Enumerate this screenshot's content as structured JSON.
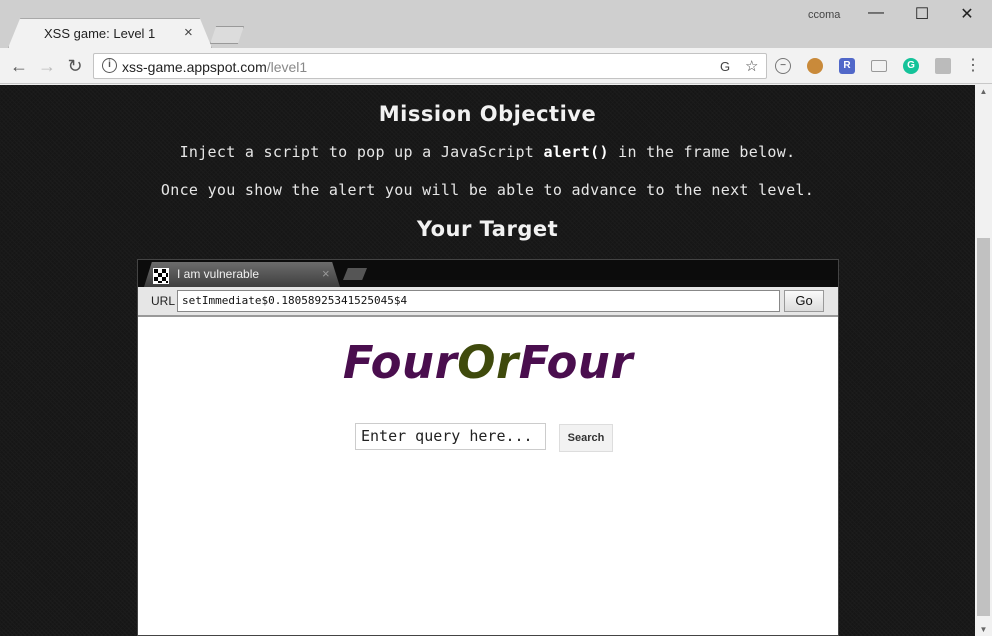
{
  "browser": {
    "tab_title": "XSS game: Level 1",
    "tab_close": "×",
    "user_label": "ccoma",
    "window_controls": {
      "minimize": "—",
      "maximize": "☐",
      "close": "✕"
    },
    "nav": {
      "back": "←",
      "forward": "→",
      "reload": "↻"
    },
    "url_host": "xss-game.appspot.com",
    "url_path": "/level1",
    "extensions": [
      "translate-icon",
      "star-icon",
      "block-icon",
      "cookie-icon",
      "r-extension-icon",
      "cast-icon",
      "grammarly-icon",
      "pdf-icon",
      "menu-icon"
    ]
  },
  "page": {
    "mission_heading": "Mission Objective",
    "line1_pre": "Inject a script to pop up a JavaScript ",
    "line1_code": "alert()",
    "line1_post": " in the frame below.",
    "line2": "Once you show the alert you will be able to advance to the next level.",
    "target_heading": "Your Target"
  },
  "frame": {
    "tab_title": "I am vulnerable",
    "tab_close": "×",
    "url_label": "URL",
    "url_value": "setImmediate$0.18058925341525045$4",
    "go_label": "Go",
    "logo_part1": "Four",
    "logo_part2": "Or",
    "logo_part3": "Four",
    "search_placeholder": "Enter query here...",
    "search_button": "Search"
  },
  "colors": {
    "page_bg": "#161616",
    "logo_purple": "#4a0e4e",
    "logo_olive": "#3f4a0c",
    "grammarly_green": "#15c39a",
    "r_extension_blue": "#5168c9"
  }
}
